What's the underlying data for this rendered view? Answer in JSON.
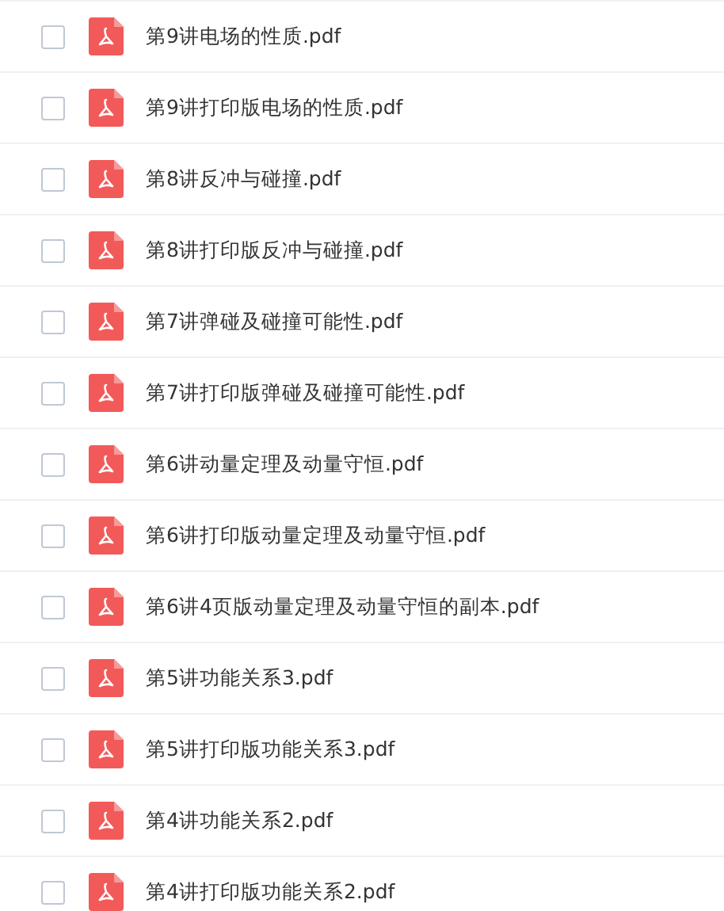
{
  "files": [
    {
      "name": "第9讲电场的性质.pdf",
      "checked": false
    },
    {
      "name": "第9讲打印版电场的性质.pdf",
      "checked": false
    },
    {
      "name": "第8讲反冲与碰撞.pdf",
      "checked": false
    },
    {
      "name": "第8讲打印版反冲与碰撞.pdf",
      "checked": false
    },
    {
      "name": "第7讲弹碰及碰撞可能性.pdf",
      "checked": false
    },
    {
      "name": "第7讲打印版弹碰及碰撞可能性.pdf",
      "checked": false
    },
    {
      "name": "第6讲动量定理及动量守恒.pdf",
      "checked": false
    },
    {
      "name": "第6讲打印版动量定理及动量守恒.pdf",
      "checked": false
    },
    {
      "name": "第6讲4页版动量定理及动量守恒的副本.pdf",
      "checked": false
    },
    {
      "name": "第5讲功能关系3.pdf",
      "checked": false
    },
    {
      "name": "第5讲打印版功能关系3.pdf",
      "checked": false
    },
    {
      "name": "第4讲功能关系2.pdf",
      "checked": false
    },
    {
      "name": "第4讲打印版功能关系2.pdf",
      "checked": false
    }
  ]
}
